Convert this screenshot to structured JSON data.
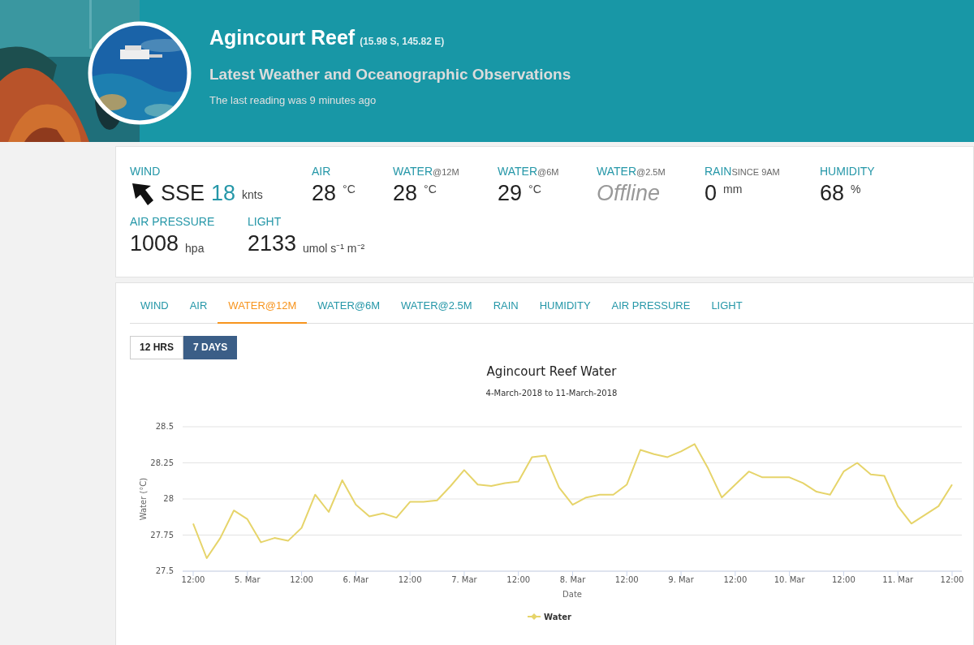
{
  "header": {
    "title": "Agincourt Reef",
    "coordinates": "(15.98 S, 145.82 E)",
    "subtitle": "Latest Weather and Oceanographic Observations",
    "last_reading": "The last reading was 9 minutes ago"
  },
  "observations": [
    [
      {
        "kind": "wind",
        "label": "WIND",
        "direction": "SSE",
        "value": "18",
        "unit": "knts"
      },
      {
        "kind": "reading",
        "label": "AIR",
        "value": "28",
        "unit": "°C"
      },
      {
        "kind": "reading",
        "label": "WATER",
        "label_suffix": "@12M",
        "value": "28",
        "unit": "°C"
      },
      {
        "kind": "reading",
        "label": "WATER",
        "label_suffix": "@6M",
        "value": "29",
        "unit": "°C"
      },
      {
        "kind": "offline",
        "label": "WATER",
        "label_suffix": "@2.5M",
        "value": "Offline"
      },
      {
        "kind": "reading",
        "label": "RAIN",
        "label_suffix": "SINCE 9AM",
        "value": "0",
        "unit": "mm"
      },
      {
        "kind": "reading",
        "label": "HUMIDITY",
        "value": "68",
        "unit": "%"
      }
    ],
    [
      {
        "kind": "reading",
        "label": "AIR PRESSURE",
        "value": "1008",
        "unit": "hpa"
      },
      {
        "kind": "reading",
        "label": "LIGHT",
        "value": "2133",
        "unit": "umol s⁻¹ m⁻²"
      }
    ]
  ],
  "tabs": [
    {
      "label": "WIND",
      "selected": false
    },
    {
      "label": "AIR",
      "selected": false
    },
    {
      "label": "WATER@12M",
      "selected": true
    },
    {
      "label": "WATER@6M",
      "selected": false
    },
    {
      "label": "WATER@2.5M",
      "selected": false
    },
    {
      "label": "RAIN",
      "selected": false
    },
    {
      "label": "HUMIDITY",
      "selected": false
    },
    {
      "label": "AIR PRESSURE",
      "selected": false
    },
    {
      "label": "LIGHT",
      "selected": false
    }
  ],
  "ranges": [
    {
      "label": "12 HRS",
      "selected": false
    },
    {
      "label": "7 DAYS",
      "selected": true
    }
  ],
  "chart": {
    "chart_data": {
      "type": "line",
      "title": "Agincourt Reef Water",
      "subtitle": "4-March-2018 to 11-March-2018",
      "xlabel": "Date",
      "ylabel": "Water (°C)",
      "ylim": [
        27.5,
        28.5
      ],
      "grid": true,
      "yticks": [
        27.5,
        27.75,
        28,
        28.25,
        28.5
      ],
      "categories": [
        "12:00",
        null,
        null,
        null,
        "5. Mar",
        null,
        null,
        null,
        "12:00",
        null,
        null,
        null,
        "6. Mar",
        null,
        null,
        null,
        "12:00",
        null,
        null,
        null,
        "7. Mar",
        null,
        null,
        null,
        "12:00",
        null,
        null,
        null,
        "8. Mar",
        null,
        null,
        null,
        "12:00",
        null,
        null,
        null,
        "9. Mar",
        null,
        null,
        null,
        "12:00",
        null,
        null,
        null,
        "10. Mar",
        null,
        null,
        null,
        "12:00",
        null,
        null,
        null,
        "11. Mar",
        null,
        null,
        null,
        "12:00"
      ],
      "series": [
        {
          "name": "Water",
          "color": "#e6d46a",
          "values": [
            27.83,
            27.59,
            27.73,
            27.92,
            27.86,
            27.7,
            27.73,
            27.71,
            27.8,
            28.03,
            27.91,
            28.13,
            27.96,
            27.88,
            27.9,
            27.87,
            27.98,
            27.98,
            27.99,
            28.09,
            28.2,
            28.1,
            28.09,
            28.11,
            28.12,
            28.29,
            28.3,
            28.08,
            27.96,
            28.01,
            28.03,
            28.03,
            28.1,
            28.34,
            28.31,
            28.29,
            28.33,
            28.38,
            28.21,
            28.01,
            28.1,
            28.19,
            28.15,
            28.15,
            28.15,
            28.11,
            28.05,
            28.03,
            28.19,
            28.25,
            28.17,
            28.16,
            27.95,
            27.83,
            27.89,
            27.95,
            28.1
          ]
        }
      ]
    }
  }
}
